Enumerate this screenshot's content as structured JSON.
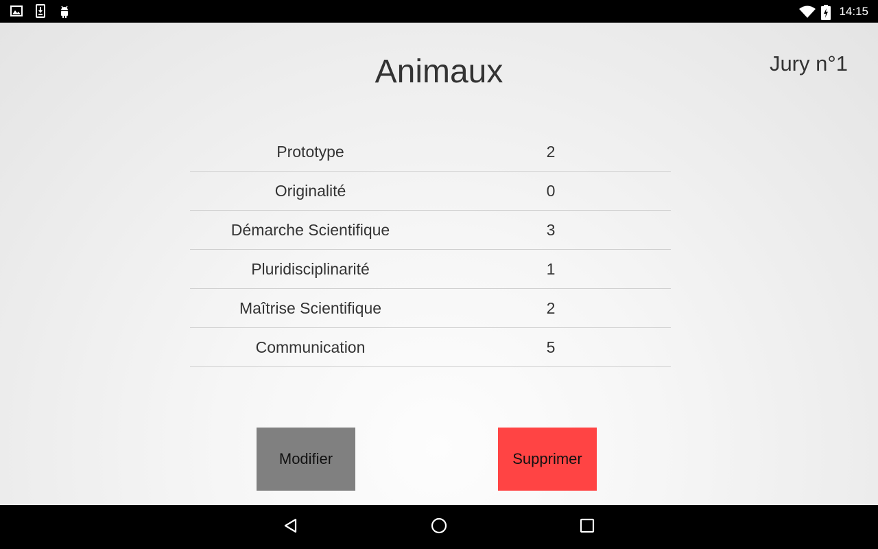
{
  "status_bar": {
    "clock": "14:15",
    "left_icons": [
      "image-icon",
      "download-icon",
      "android-debug-icon"
    ],
    "right_icons": [
      "wifi-icon",
      "battery-charging-icon"
    ]
  },
  "header": {
    "title": "Animaux",
    "jury_label": "Jury n°1"
  },
  "scores": [
    {
      "label": "Prototype",
      "value": "2"
    },
    {
      "label": "Originalité",
      "value": "0"
    },
    {
      "label": "Démarche Scientifique",
      "value": "3"
    },
    {
      "label": "Pluridisciplinarité",
      "value": "1"
    },
    {
      "label": "Maîtrise Scientifique",
      "value": "2"
    },
    {
      "label": "Communication",
      "value": "5"
    }
  ],
  "actions": {
    "modify_label": "Modifier",
    "delete_label": "Supprimer"
  },
  "colors": {
    "modify_button": "#808080",
    "delete_button": "#ff4444"
  },
  "nav_bar": {
    "icons": [
      "back-icon",
      "home-icon",
      "recents-icon"
    ]
  }
}
